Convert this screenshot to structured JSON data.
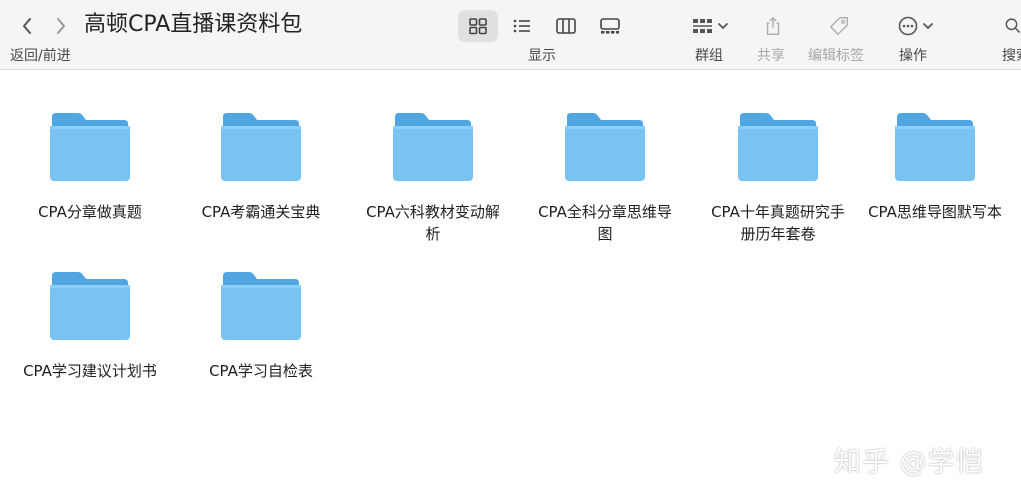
{
  "window": {
    "title": "高顿CPA直播课资料包"
  },
  "toolbar": {
    "nav_label": "返回/前进",
    "view_label": "显示",
    "group_label": "群组",
    "share_label": "共享",
    "tags_label": "编辑标签",
    "action_label": "操作",
    "search_label": "搜索",
    "icons": [
      "chevron-left-icon",
      "chevron-right-icon",
      "grid-view-icon",
      "list-view-icon",
      "column-view-icon",
      "gallery-view-icon",
      "group-icon",
      "share-icon",
      "tag-icon",
      "more-icon",
      "search-icon"
    ],
    "active_view": "grid"
  },
  "folders": [
    {
      "name": "CPA分章做真题"
    },
    {
      "name": "CPA考霸通关宝典"
    },
    {
      "name": "CPA六科教材变动解析"
    },
    {
      "name": "CPA全科分章思维导图"
    },
    {
      "name": "CPA十年真题研究手册历年套卷"
    },
    {
      "name": "CPA思维导图默写本"
    },
    {
      "name": "CPA学习建议计划书"
    },
    {
      "name": "CPA学习自检表"
    }
  ],
  "watermark": {
    "text": "知乎 @学恺"
  },
  "colors": {
    "folder_body": "#79c3f2",
    "folder_tab": "#4fa6e3",
    "toolbar_bg": "#f5f5f5"
  }
}
